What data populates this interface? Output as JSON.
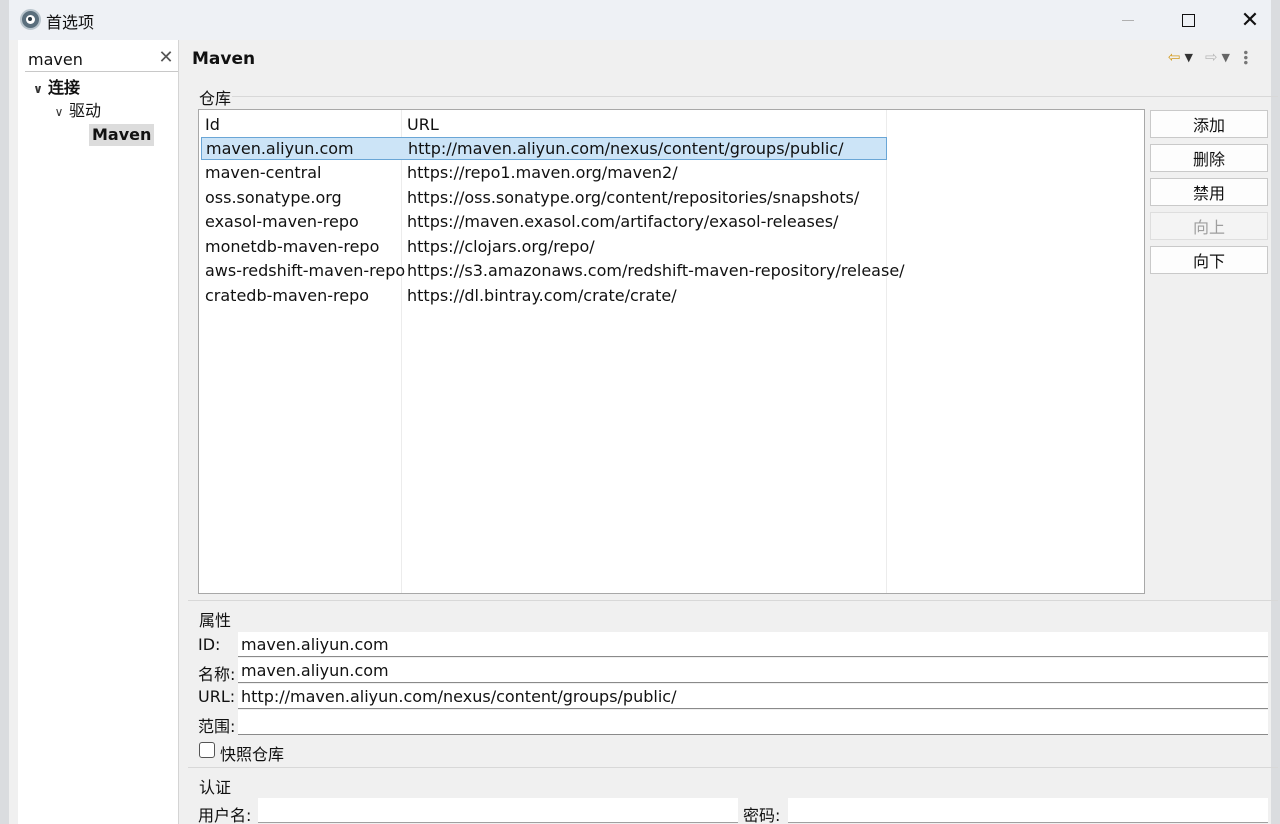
{
  "window": {
    "title": "首选项",
    "close_glyph": "✕"
  },
  "sidebar": {
    "filter_value": "maven",
    "clear_glyph": "✕",
    "tree": [
      {
        "label": "连接",
        "expanded": true
      },
      {
        "label": "驱动",
        "expanded": true
      },
      {
        "label": "Maven",
        "selected": true
      }
    ]
  },
  "main": {
    "page_title": "Maven",
    "repo_group_label": "仓库",
    "table": {
      "headers": [
        "Id",
        "URL"
      ],
      "rows": [
        {
          "id": "maven.aliyun.com",
          "url": "http://maven.aliyun.com/nexus/content/groups/public/",
          "selected": true
        },
        {
          "id": "maven-central",
          "url": "https://repo1.maven.org/maven2/"
        },
        {
          "id": "oss.sonatype.org",
          "url": "https://oss.sonatype.org/content/repositories/snapshots/"
        },
        {
          "id": "exasol-maven-repo",
          "url": "https://maven.exasol.com/artifactory/exasol-releases/"
        },
        {
          "id": "monetdb-maven-repo",
          "url": "https://clojars.org/repo/"
        },
        {
          "id": "aws-redshift-maven-repo",
          "url": "https://s3.amazonaws.com/redshift-maven-repository/release/"
        },
        {
          "id": "cratedb-maven-repo",
          "url": "https://dl.bintray.com/crate/crate/"
        }
      ]
    },
    "buttons": {
      "add": "添加",
      "delete": "删除",
      "disable": "禁用",
      "up": "向上",
      "down": "向下"
    },
    "properties": {
      "group_label": "属性",
      "id_label": "ID:",
      "id_value": "maven.aliyun.com",
      "name_label": "名称:",
      "name_value": "maven.aliyun.com",
      "url_label": "URL:",
      "url_value": "http://maven.aliyun.com/nexus/content/groups/public/",
      "scope_label": "范围:",
      "scope_value": "",
      "snapshot_label": "快照仓库",
      "snapshot_checked": false
    },
    "auth": {
      "group_label": "认证",
      "username_label": "用户名:",
      "username_value": "",
      "password_label": "密码:",
      "password_value": ""
    }
  },
  "colors": {
    "selection_bg": "#cce4f7",
    "selection_border": "#6aa6d6",
    "nav_back": "#d29a1e"
  }
}
